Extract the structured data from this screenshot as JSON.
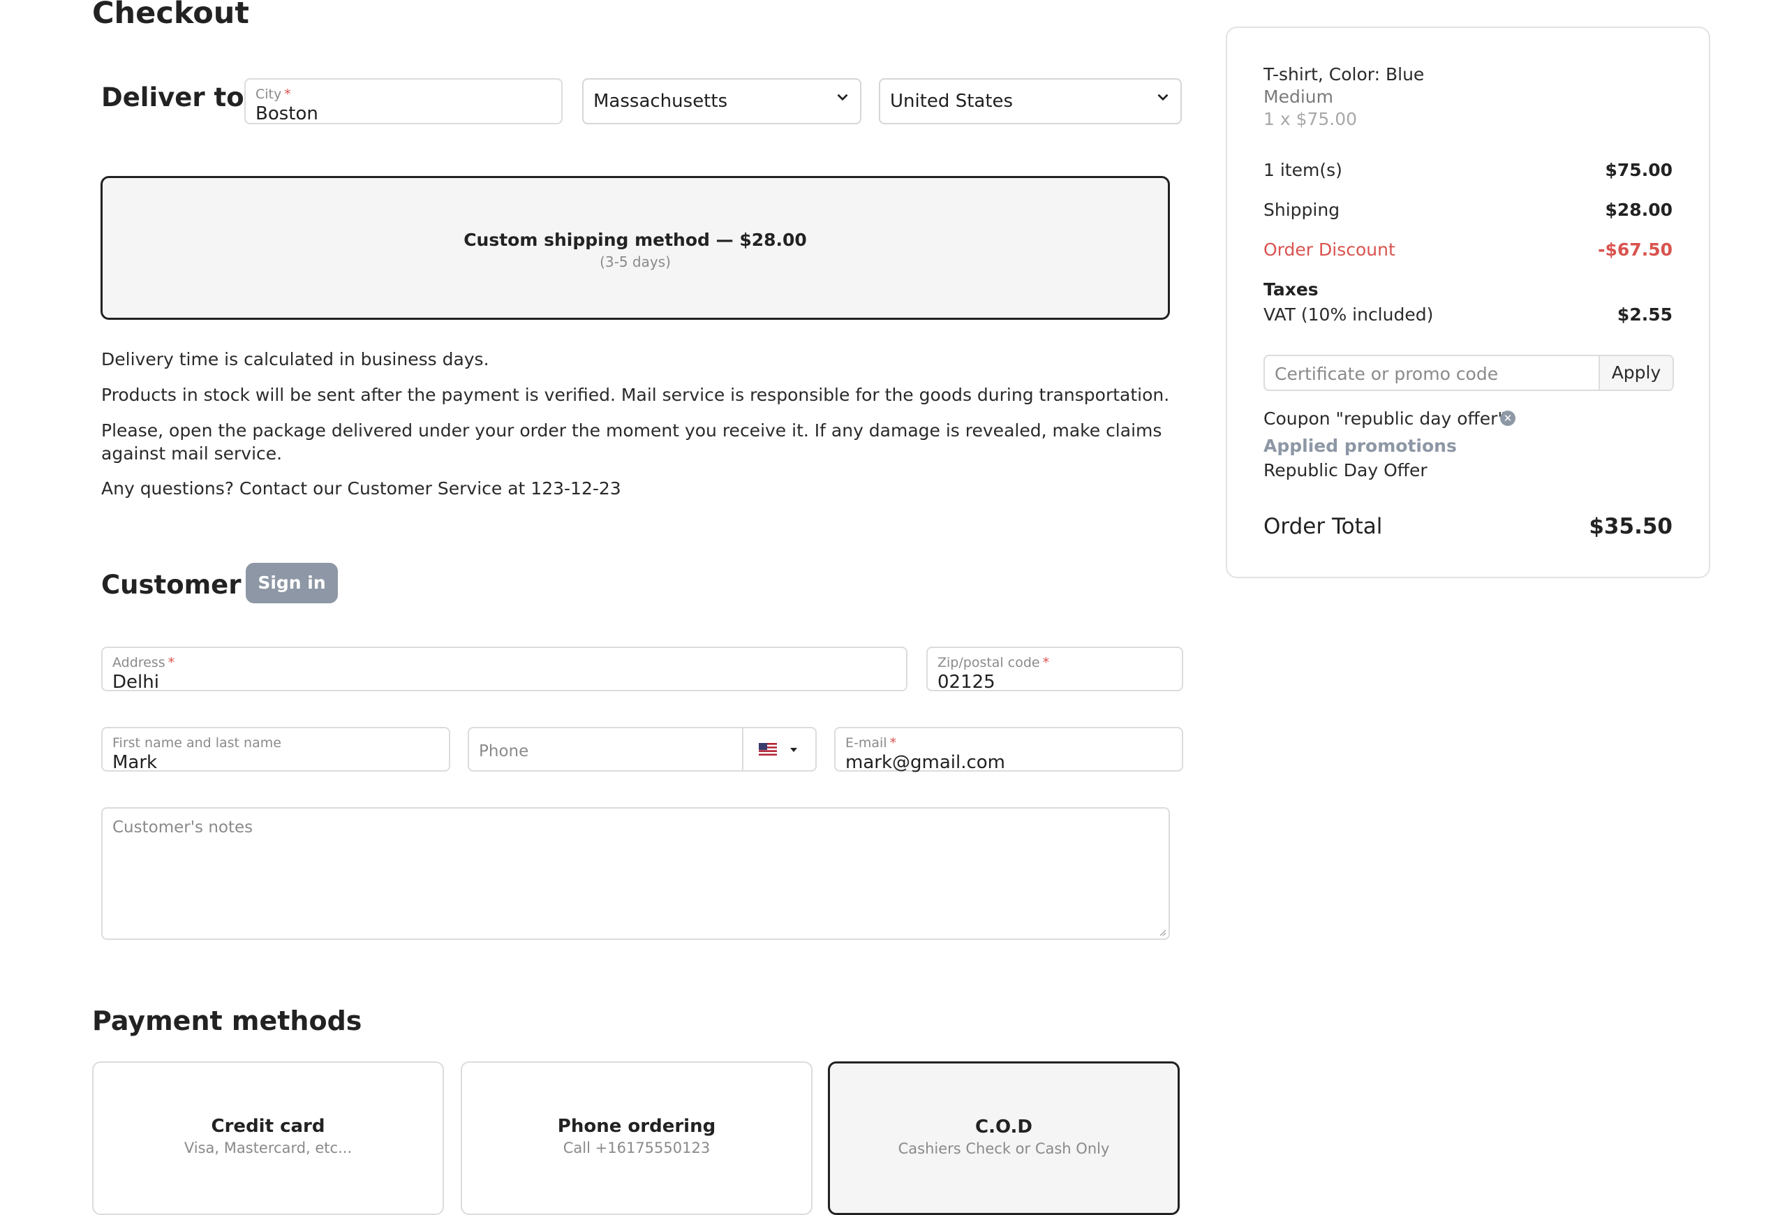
{
  "page_title": "Checkout",
  "deliver": {
    "title": "Deliver to",
    "city": {
      "label": "City",
      "value": "Boston"
    },
    "state": {
      "value": "Massachusetts"
    },
    "country": {
      "value": "United States"
    }
  },
  "shipping": {
    "method": "Custom shipping method — $28.00",
    "days": "(3-5 days)"
  },
  "info": [
    "Delivery time is calculated in business days.",
    "Products in stock will be sent after the payment is verified. Mail service is responsible for the goods during transportation.",
    "Please, open the package delivered under your order the moment you receive it. If any damage is revealed, make claims against mail service.",
    "Any questions? Contact our Customer Service at 123-12-23"
  ],
  "customer": {
    "title": "Customer",
    "signin_label": "Sign in",
    "address": {
      "label": "Address",
      "value": "Delhi"
    },
    "zip": {
      "label": "Zip/postal code",
      "value": "02125"
    },
    "name": {
      "label": "First name and last name",
      "value": "Mark"
    },
    "phone": {
      "placeholder": "Phone"
    },
    "email": {
      "label": "E-mail",
      "value": "mark@gmail.com"
    },
    "notes": {
      "placeholder": "Customer's notes"
    }
  },
  "payment": {
    "title": "Payment methods",
    "methods": [
      {
        "name": "Credit card",
        "desc": "Visa, Mastercard, etc..."
      },
      {
        "name": "Phone ordering",
        "desc": "Call +16175550123"
      },
      {
        "name": "C.O.D",
        "desc": "Cashiers Check or Cash Only"
      }
    ]
  },
  "summary": {
    "item_name": "T-shirt, Color: Blue",
    "item_variant": "Medium",
    "item_qty_price": "1 x $75.00",
    "items_label": "1 item(s)",
    "items_value": "$75.00",
    "shipping_label": "Shipping",
    "shipping_value": "$28.00",
    "discount_label": "Order Discount",
    "discount_value": "-$67.50",
    "taxes_label": "Taxes",
    "vat_label": "VAT (10% included)",
    "vat_value": "$2.55",
    "promo_placeholder": "Certificate or promo code",
    "apply_label": "Apply",
    "coupon_text": "Coupon \"republic day offer\"",
    "applied_label": "Applied promotions",
    "promotion_name": "Republic Day Offer",
    "total_label": "Order Total",
    "total_value": "$35.50"
  },
  "colors": {
    "accent_red": "#d9534f",
    "signin_bg": "#8d97a5",
    "selected_border": "#222222"
  }
}
